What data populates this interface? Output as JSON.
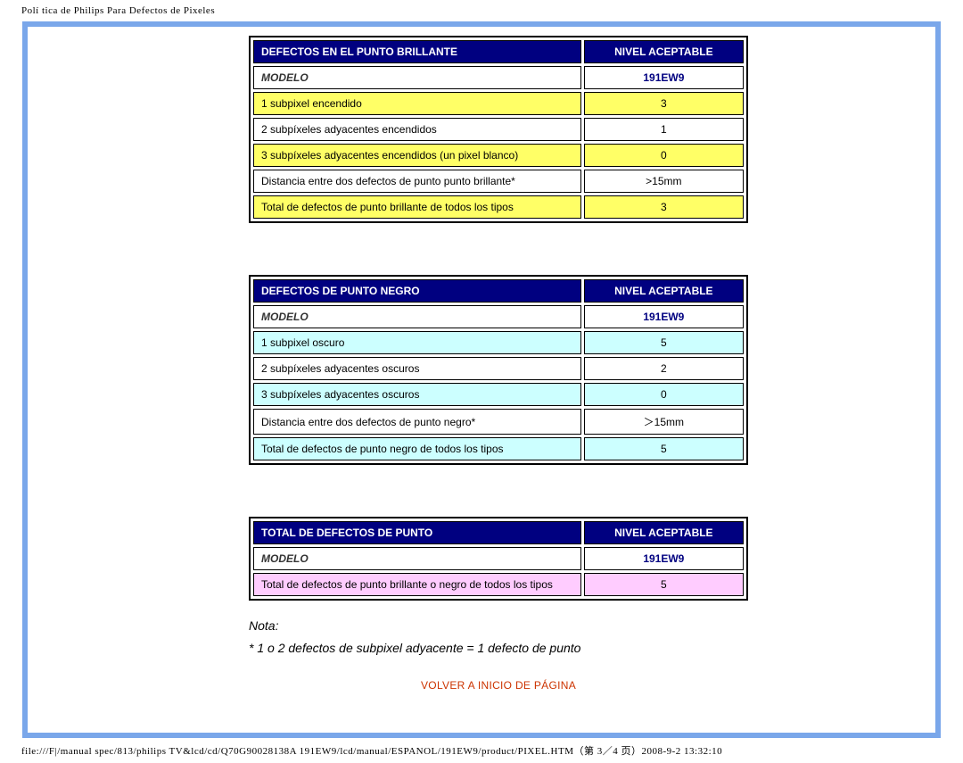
{
  "page_title": "Polí tica de Philips Para Defectos de Pixeles",
  "footer": "file:///F|/manual spec/813/philips TV&lcd/cd/Q70G90028138A 191EW9/lcd/manual/ESPANOL/191EW9/product/PIXEL.HTM（第 3／4 页）2008-9-2 13:32:10",
  "nivel": "NIVEL ACEPTABLE",
  "modelo_label": "MODELO",
  "model_value": "191EW9",
  "table1": {
    "title": "DEFECTOS EN EL PUNTO BRILLANTE",
    "rows": [
      {
        "cls": "row-yellow",
        "label": "1 subpixel encendido",
        "val": "3"
      },
      {
        "cls": "row-white",
        "label": "2 subpíxeles adyacentes encendidos",
        "val": "1"
      },
      {
        "cls": "row-yellow",
        "label": "3 subpíxeles adyacentes encendidos (un pixel blanco)",
        "val": "0"
      },
      {
        "cls": "row-white",
        "label": "Distancia entre dos defectos de punto punto brillante*",
        "val": ">15mm"
      },
      {
        "cls": "row-yellow",
        "label": "Total de defectos de punto brillante de todos los tipos",
        "val": "3"
      }
    ]
  },
  "table2": {
    "title": "DEFECTOS DE PUNTO NEGRO",
    "rows": [
      {
        "cls": "row-cyan",
        "label": "1 subpixel oscuro",
        "val": "5"
      },
      {
        "cls": "row-white",
        "label": "2 subpíxeles adyacentes oscuros",
        "val": "2"
      },
      {
        "cls": "row-cyan",
        "label": "3 subpíxeles adyacentes oscuros",
        "val": "0"
      },
      {
        "cls": "row-white",
        "label": "Distancia entre dos defectos de punto negro*",
        "val": "＞15mm"
      },
      {
        "cls": "row-cyan",
        "label": "Total de defectos de punto negro de todos los tipos",
        "val": "5"
      }
    ]
  },
  "table3": {
    "title": "TOTAL DE DEFECTOS DE PUNTO",
    "rows": [
      {
        "cls": "row-pink",
        "label": "Total de defectos de punto brillante o negro de todos los tipos",
        "val": "5"
      }
    ]
  },
  "note": {
    "heading": "Nota:",
    "line": "* 1 o 2 defectos de subpixel adyacente = 1 defecto de punto"
  },
  "back_link": "VOLVER A INICIO DE PÁGINA"
}
